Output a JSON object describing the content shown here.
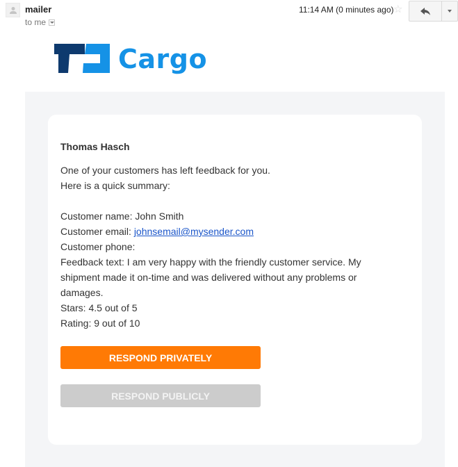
{
  "header": {
    "sender": "mailer",
    "recipient": "to me",
    "timestamp": "11:14 AM (0 minutes ago)",
    "icons": {
      "avatar": "person-icon",
      "recipient_dropdown": "caret-down-icon",
      "star": "star-icon",
      "reply": "reply-arrow-icon",
      "more": "caret-down-icon"
    }
  },
  "brand": {
    "name": "Cargo",
    "colors": {
      "dark": "#0e3a6e",
      "light": "#1592e6"
    }
  },
  "email": {
    "greeting_name": "Thomas Hasch",
    "intro_line_1": "One of your customers has left feedback for you.",
    "intro_line_2": "Here is a quick summary:",
    "customer_name_label": "Customer name: ",
    "customer_name": "John Smith",
    "customer_email_label": "Customer email: ",
    "customer_email": "johnsemail@mysender.com",
    "customer_phone_label": "Customer phone:",
    "customer_phone": "",
    "feedback_label": "Feedback text: ",
    "feedback_text": "I am very happy with the friendly customer service. My shipment made it on-time and was delivered without any problems or damages.",
    "stars_label": "Stars: ",
    "stars": "4.5 out of 5",
    "rating_label": "Rating: ",
    "rating": "9 out of 10"
  },
  "buttons": {
    "respond_privately": "RESPOND PRIVATELY",
    "respond_publicly": "RESPOND PUBLICLY",
    "colors": {
      "private": "#ff7a05",
      "public": "#cccccc"
    }
  }
}
